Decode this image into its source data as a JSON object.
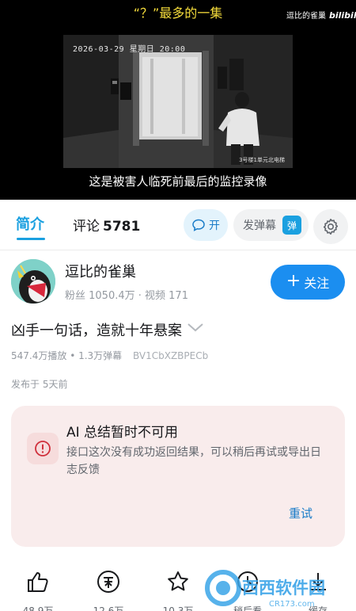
{
  "player": {
    "title_overlay": "“？”最多的一集",
    "logo_text": "逗比的雀巢",
    "brand": "bilibili",
    "timestamp": "2026-03-29 星期日 20:00",
    "cctv_label": "3号楼1单元北电梯",
    "subtitle": "这是被害人临死前最后的监控录像"
  },
  "tabs": {
    "intro": "简介",
    "comments_label": "评论",
    "comments_count": "5781",
    "danmaku_toggle": "开",
    "send_danmaku": "发弹幕",
    "danmaku_badge": "弹"
  },
  "uploader": {
    "name": "逗比的雀巢",
    "stats": "粉丝 1050.4万 · 视频 171",
    "follow_label": "关注"
  },
  "video": {
    "title": "凶手一句话，造就十年悬案",
    "plays": "547.4万播放",
    "danmaku": "1.3万弹幕",
    "bvid": "BV1CbXZBPECb",
    "published": "发布于 5天前"
  },
  "ai_summary": {
    "title": "AI 总结暂时不可用",
    "message": "接口这次没有成功返回结果，可以稍后再试或导出日志反馈",
    "retry": "重试"
  },
  "actions": {
    "like": "48.9万",
    "coin": "12.6万",
    "favorite": "10.3万",
    "watch_later": "稍后看",
    "cache": "缓存"
  },
  "watermark": {
    "text": "西西软件园",
    "domain": "CR173.com"
  },
  "colors": {
    "accent": "#1aa0e0",
    "follow": "#1b8ef0",
    "subtitle_yellow": "#f5dc3b",
    "error_card": "#f9ecec"
  }
}
